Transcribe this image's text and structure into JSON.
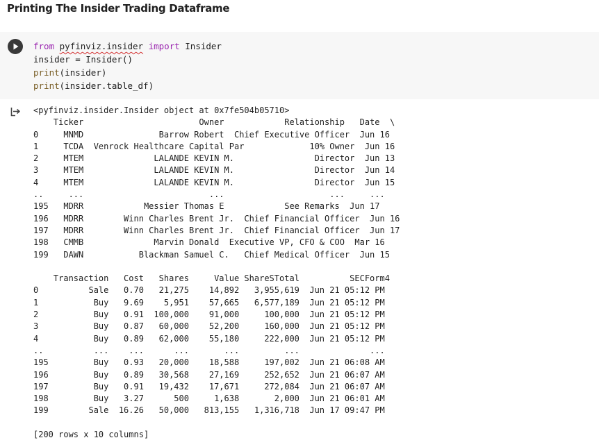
{
  "heading": "Printing The Insider Trading Dataframe",
  "cell": {
    "code_lines": [
      {
        "parts": [
          {
            "text": "from",
            "cls": "kw"
          },
          {
            "text": " ",
            "cls": ""
          },
          {
            "text": "pyfinviz.insider",
            "cls": "squiggle"
          },
          {
            "text": " ",
            "cls": ""
          },
          {
            "text": "import",
            "cls": "kw"
          },
          {
            "text": " Insider",
            "cls": ""
          }
        ]
      },
      {
        "parts": [
          {
            "text": "insider = Insider()",
            "cls": ""
          }
        ]
      },
      {
        "parts": [
          {
            "text": "print",
            "cls": "fn"
          },
          {
            "text": "(insider)",
            "cls": ""
          }
        ]
      },
      {
        "parts": [
          {
            "text": "print",
            "cls": "fn"
          },
          {
            "text": "(insider.table_df)",
            "cls": ""
          }
        ]
      }
    ],
    "run_icon": "play-icon",
    "output_icon": "output-toggle-icon"
  },
  "output": {
    "object_repr": "<pyfinviz.insider.Insider object at 0x7fe504b05710>",
    "table1": {
      "header": "    Ticker                       Owner            Relationship   Date  \\",
      "rows": [
        "0     MNMD               Barrow Robert  Chief Executive Officer  Jun 16",
        "1     TCDA  Venrock Healthcare Capital Par             10% Owner  Jun 16",
        "2     MTEM              LALANDE KEVIN M.                Director  Jun 13",
        "3     MTEM              LALANDE KEVIN M.                Director  Jun 14",
        "4     MTEM              LALANDE KEVIN M.                Director  Jun 15",
        "..     ...                         ...                     ...     ...",
        "195   MDRR            Messier Thomas E            See Remarks  Jun 17",
        "196   MDRR        Winn Charles Brent Jr.  Chief Financial Officer  Jun 16",
        "197   MDRR        Winn Charles Brent Jr.  Chief Financial Officer  Jun 17",
        "198   CMMB              Marvin Donald  Executive VP, CFO & COO  Mar 16",
        "199   DAWN           Blackman Samuel C.   Chief Medical Officer  Jun 15"
      ]
    },
    "table2": {
      "header": "    Transaction   Cost   Shares     Value ShareSTotal          SECForm4",
      "rows": [
        "0          Sale   0.70   21,275    14,892   3,955,619  Jun 21 05:12 PM",
        "1           Buy   9.69    5,951    57,665   6,577,189  Jun 21 05:12 PM",
        "2           Buy   0.91  100,000    91,000     100,000  Jun 21 05:12 PM",
        "3           Buy   0.87   60,000    52,200     160,000  Jun 21 05:12 PM",
        "4           Buy   0.89   62,000    55,180     222,000  Jun 21 05:12 PM",
        "..          ...    ...      ...       ...         ...              ...",
        "195         Buy   0.93   20,000    18,588     197,002  Jun 21 06:08 AM",
        "196         Buy   0.89   30,568    27,169     252,652  Jun 21 06:07 AM",
        "197         Buy   0.91   19,432    17,671     272,084  Jun 21 06:07 AM",
        "198         Buy   3.27      500     1,638       2,000  Jun 21 06:01 AM",
        "199        Sale  16.26   50,000   813,155   1,316,718  Jun 17 09:47 PM"
      ]
    },
    "footer": "[200 rows x 10 columns]"
  }
}
